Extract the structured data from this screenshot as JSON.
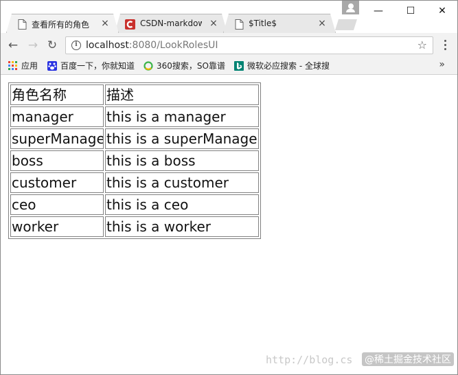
{
  "tabs": [
    {
      "title": "查看所有的角色",
      "close": "×",
      "icon": "page-icon"
    },
    {
      "title": "CSDN-markdown",
      "close": "×",
      "icon": "csdn-icon"
    },
    {
      "title": "$Title$",
      "close": "×",
      "icon": "page-icon"
    }
  ],
  "window_controls": {
    "minimize": "—",
    "maximize": "☐",
    "close": "✕"
  },
  "toolbar": {
    "back": "←",
    "forward": "→",
    "reload": "↻",
    "info": "i",
    "url_host": "localhost",
    "url_rest": ":8080/LookRolesUI",
    "star": "☆"
  },
  "bookmarks": [
    {
      "label": "应用",
      "icon": "apps-icon"
    },
    {
      "label": "百度一下，你就知道",
      "icon": "baidu-paw-icon"
    },
    {
      "label": "360搜索，SO靠谱",
      "icon": "360-icon"
    },
    {
      "label": "微软必应搜索 - 全球搜",
      "icon": "bing-icon"
    }
  ],
  "bookmarks_more": "»",
  "table": {
    "headers": [
      "角色名称",
      "描述"
    ],
    "rows": [
      [
        "manager",
        "this is a manager"
      ],
      [
        "superManage",
        "this is a superManage"
      ],
      [
        "boss",
        "this is a boss"
      ],
      [
        "customer",
        "this is a customer"
      ],
      [
        "ceo",
        "this is a ceo"
      ],
      [
        "worker",
        "this is a worker"
      ]
    ]
  },
  "watermark": {
    "url": "http://blog.cs",
    "badge": "@稀土掘金技术社区"
  },
  "colors": {
    "csdn_red": "#c9302c",
    "bing_teal": "#008373",
    "baidu_blue": "#2932e1",
    "360_green": "#3bb44a"
  }
}
